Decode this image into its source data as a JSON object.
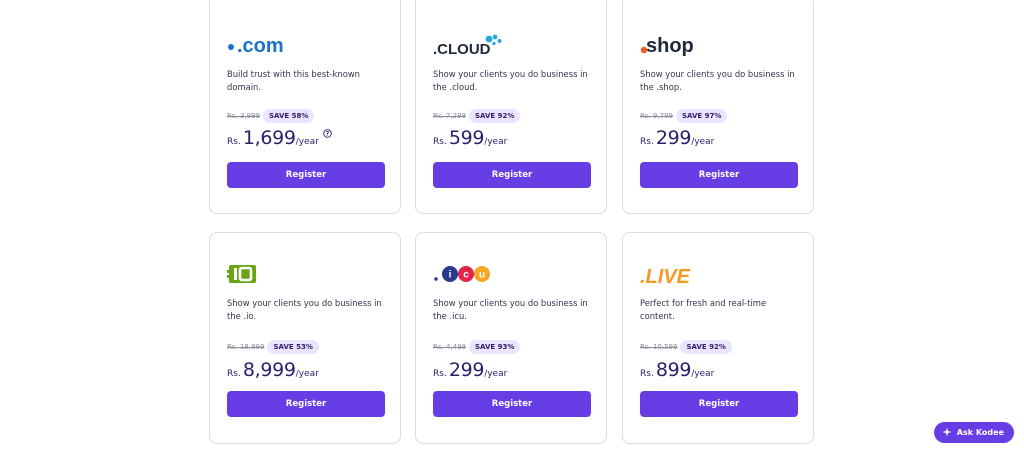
{
  "cards": [
    {
      "tld": ".com",
      "description": "Build trust with this best-known domain.",
      "old_price": "Rs. 3,999",
      "save": "SAVE 58%",
      "currency": "Rs.",
      "price": "1,699",
      "per": "/year",
      "button": "Register"
    },
    {
      "tld": ".CLOUD",
      "description": "Show your clients you do business in the .cloud.",
      "old_price": "Rs. 7,299",
      "save": "SAVE 92%",
      "currency": "Rs.",
      "price": "599",
      "per": "/year",
      "button": "Register"
    },
    {
      "tld": ".shop",
      "description": "Show your clients you do business in the .shop.",
      "old_price": "Rs. 9,799",
      "save": "SAVE 97%",
      "currency": "Rs.",
      "price": "299",
      "per": "/year",
      "button": "Register"
    },
    {
      "tld": "IO",
      "description": "Show your clients you do business in the .io.",
      "old_price": "Rs. 18,999",
      "save": "SAVE 53%",
      "currency": "Rs.",
      "price": "8,999",
      "per": "/year",
      "button": "Register"
    },
    {
      "tld": "ICU",
      "description": "Show your clients you do business in the .icu.",
      "old_price": "Rs. 4,499",
      "save": "SAVE 93%",
      "currency": "Rs.",
      "price": "299",
      "per": "/year",
      "button": "Register"
    },
    {
      "tld": ".LIVE",
      "description": "Perfect for fresh and real-time content.",
      "old_price": "Rs. 10,599",
      "save": "SAVE 92%",
      "currency": "Rs.",
      "price": "899",
      "per": "/year",
      "button": "Register"
    }
  ],
  "info_icon": "question-circle-icon",
  "assistant": {
    "label": "Ask Kodee",
    "icon": "sparkle-icon"
  },
  "colors": {
    "primary": "#673de6",
    "text": "#2f1c6a",
    "badge": "#ebe4ff"
  }
}
